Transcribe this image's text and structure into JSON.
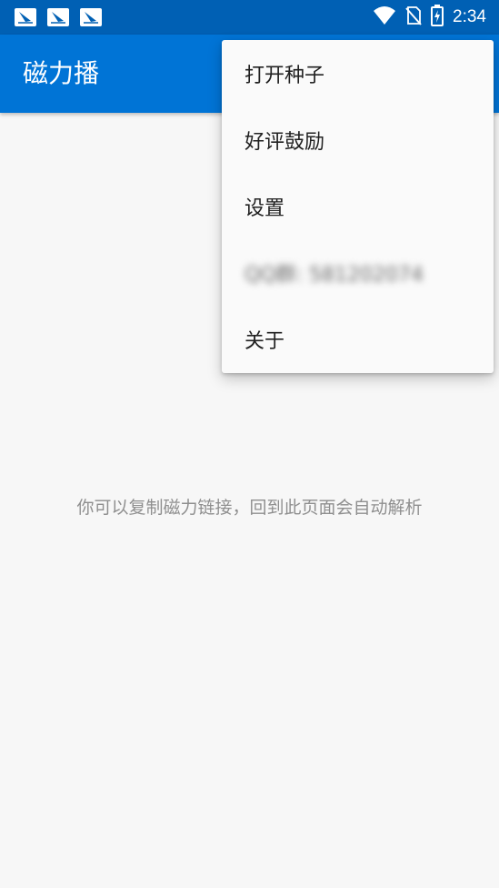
{
  "status_bar": {
    "time": "2:34",
    "notification_icons": [
      "app-notification-icon",
      "app-notification-icon",
      "app-notification-icon"
    ],
    "system_icons": [
      "wifi-icon",
      "no-sim-icon",
      "battery-charging-icon"
    ]
  },
  "app_bar": {
    "title": "磁力播",
    "background": "#0074d6",
    "status_background": "#0060b4"
  },
  "main": {
    "hint": "你可以复制磁力链接，回到此页面会自动解析"
  },
  "overflow_menu": {
    "items": [
      {
        "label": "打开种子"
      },
      {
        "label": "好评鼓励"
      },
      {
        "label": "设置"
      },
      {
        "label": "QQ群: 581202074"
      },
      {
        "label": "关于"
      }
    ]
  }
}
